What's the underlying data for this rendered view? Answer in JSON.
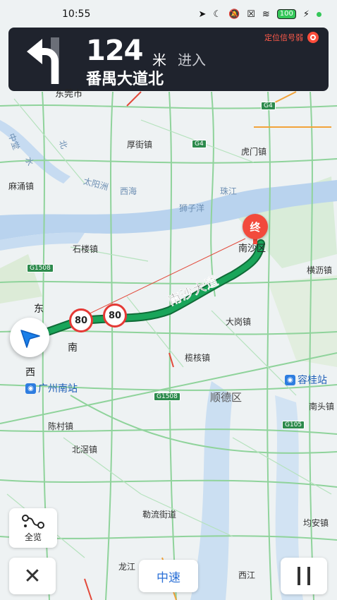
{
  "status": {
    "time": "10:55",
    "battery": "100"
  },
  "guidance": {
    "distance": "124",
    "unit": "米",
    "action": "进入",
    "road": "番禺大道北",
    "gps_warning": "定位信号弱"
  },
  "map": {
    "labels": {
      "dongguan": "东莞市",
      "houjie": "厚街镇",
      "humen": "虎门镇",
      "mayong": "麻涌镇",
      "taiyang": "太阳洲",
      "xiyang": "西海",
      "zhujiang": "珠江",
      "shiziyang": "狮子洋",
      "shilou": "石楼镇",
      "nansha": "南沙区",
      "henglitown": "横沥镇",
      "dagang": "大岗镇",
      "lanhe": "榄核镇",
      "shunde": "顺德区",
      "chencun": "陈村镇",
      "beijiao": "北滘镇",
      "leliu": "勒流街道",
      "nantou": "南头镇",
      "junan": "均安镇",
      "longjiang": "龙江",
      "xijiang": "西江",
      "east": "东",
      "south": "南",
      "west": "西",
      "zhongtang": "中堂",
      "shui": "水",
      "bei": "北",
      "road_name": "南沙大道"
    },
    "shields": [
      "G1508",
      "G1508",
      "G4",
      "G4",
      "G105"
    ],
    "speed_limits": [
      "80",
      "80"
    ],
    "stations": [
      "广州南站",
      "容桂站"
    ],
    "end_label": "终"
  },
  "controls": {
    "overview": "全览",
    "speed_mode": "中速"
  },
  "colors": {
    "route": "#1aa55a",
    "banner": "#1f232d",
    "accent": "#2a6fd6",
    "end_pin": "#f24a3c"
  }
}
